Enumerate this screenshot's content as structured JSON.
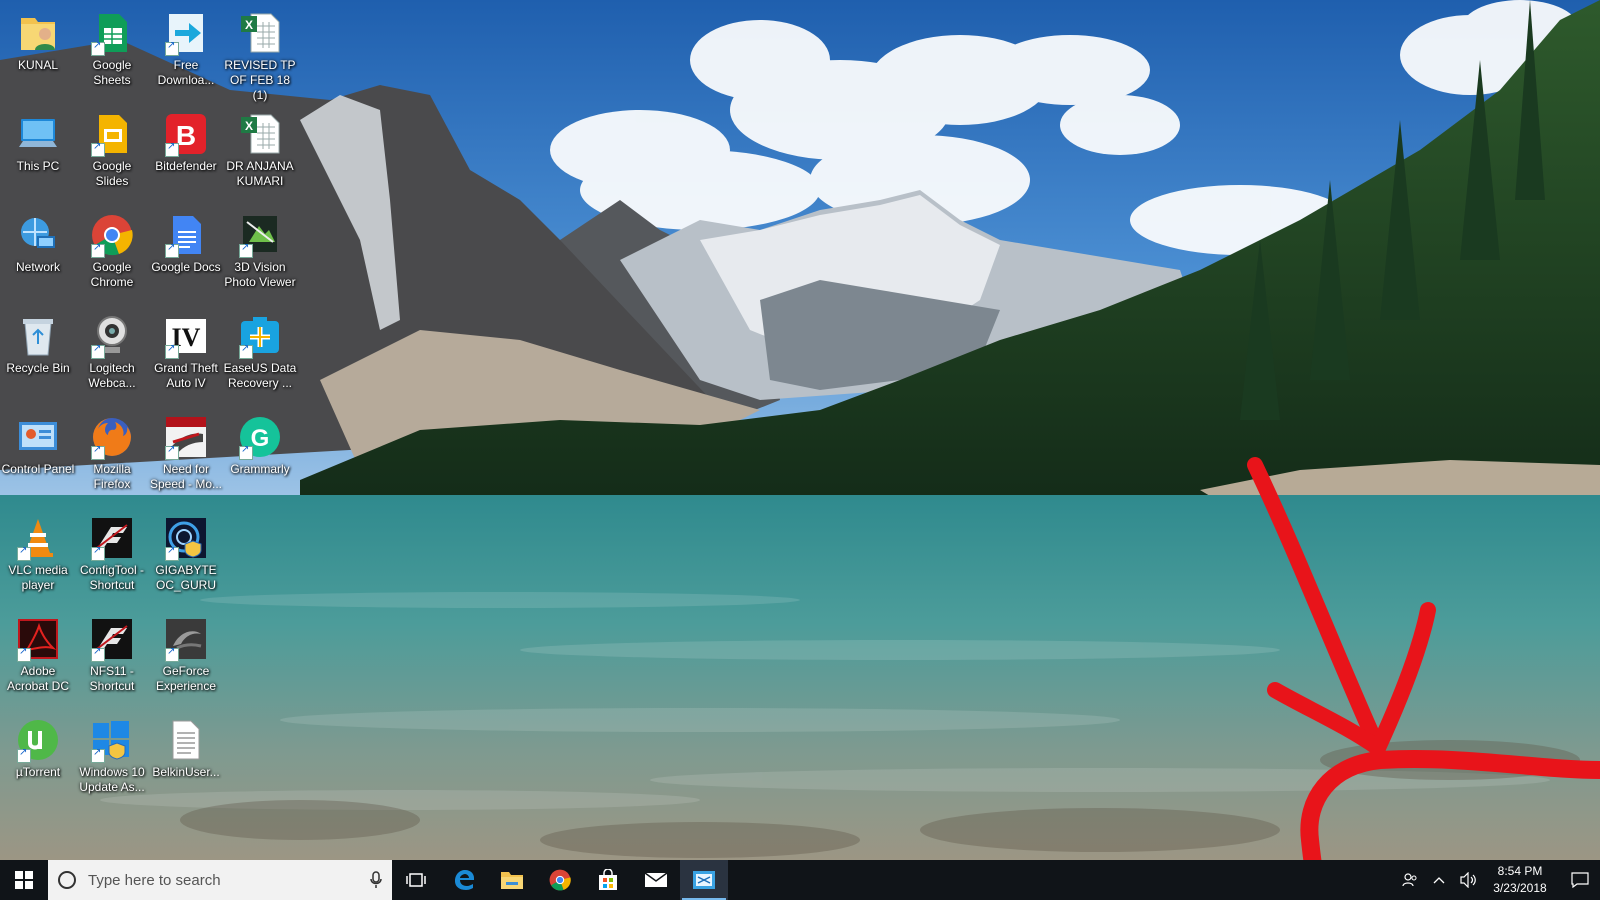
{
  "desktop": {
    "icons": [
      {
        "label": "KUNAL",
        "icon": "user-folder-icon"
      },
      {
        "label": "Google Sheets",
        "icon": "google-sheets-icon"
      },
      {
        "label": "Free Downloa...",
        "icon": "free-download-manager-icon"
      },
      {
        "label": "REVISED TP OF FEB 18 (1)",
        "icon": "excel-file-icon"
      },
      {
        "label": "This PC",
        "icon": "this-pc-icon"
      },
      {
        "label": "Google Slides",
        "icon": "google-slides-icon"
      },
      {
        "label": "Bitdefender",
        "icon": "bitdefender-icon"
      },
      {
        "label": "DR ANJANA KUMARI",
        "icon": "excel-file-icon"
      },
      {
        "label": "Network",
        "icon": "network-icon"
      },
      {
        "label": "Google Chrome",
        "icon": "chrome-icon"
      },
      {
        "label": "Google Docs",
        "icon": "google-docs-icon"
      },
      {
        "label": "3D Vision Photo Viewer",
        "icon": "3d-vision-icon"
      },
      {
        "label": "Recycle Bin",
        "icon": "recycle-bin-icon"
      },
      {
        "label": "Logitech Webca...",
        "icon": "webcam-icon"
      },
      {
        "label": "Grand Theft Auto IV",
        "icon": "gta-iv-icon"
      },
      {
        "label": "EaseUS Data Recovery ...",
        "icon": "easeus-icon"
      },
      {
        "label": "Control Panel",
        "icon": "control-panel-icon"
      },
      {
        "label": "Mozilla Firefox",
        "icon": "firefox-icon"
      },
      {
        "label": "Need for Speed - Mo...",
        "icon": "nfs-icon"
      },
      {
        "label": "Grammarly",
        "icon": "grammarly-icon"
      },
      {
        "label": "VLC media player",
        "icon": "vlc-icon"
      },
      {
        "label": "ConfigTool - Shortcut",
        "icon": "configtool-icon"
      },
      {
        "label": "GIGABYTE OC_GURU",
        "icon": "gigabyte-icon"
      },
      {
        "label": "Adobe Acrobat DC",
        "icon": "acrobat-icon"
      },
      {
        "label": "NFS11 - Shortcut",
        "icon": "nfs11-icon"
      },
      {
        "label": "GeForce Experience",
        "icon": "geforce-icon"
      },
      {
        "label": "µTorrent",
        "icon": "utorrent-icon"
      },
      {
        "label": "Windows 10 Update As...",
        "icon": "windows-update-icon"
      },
      {
        "label": "BelkinUser...",
        "icon": "text-file-icon"
      }
    ]
  },
  "taskbar": {
    "search_placeholder": "Type here to search",
    "pinned": [
      "task-view-icon",
      "edge-icon",
      "file-explorer-icon",
      "chrome-icon",
      "store-icon",
      "mail-icon",
      "snipping-tool-icon"
    ],
    "clock_time": "8:54 PM",
    "clock_date": "3/23/2018"
  },
  "colors": {
    "taskbar": "#101418",
    "annotation": "#e8141a",
    "accent": "#76b9ed"
  }
}
